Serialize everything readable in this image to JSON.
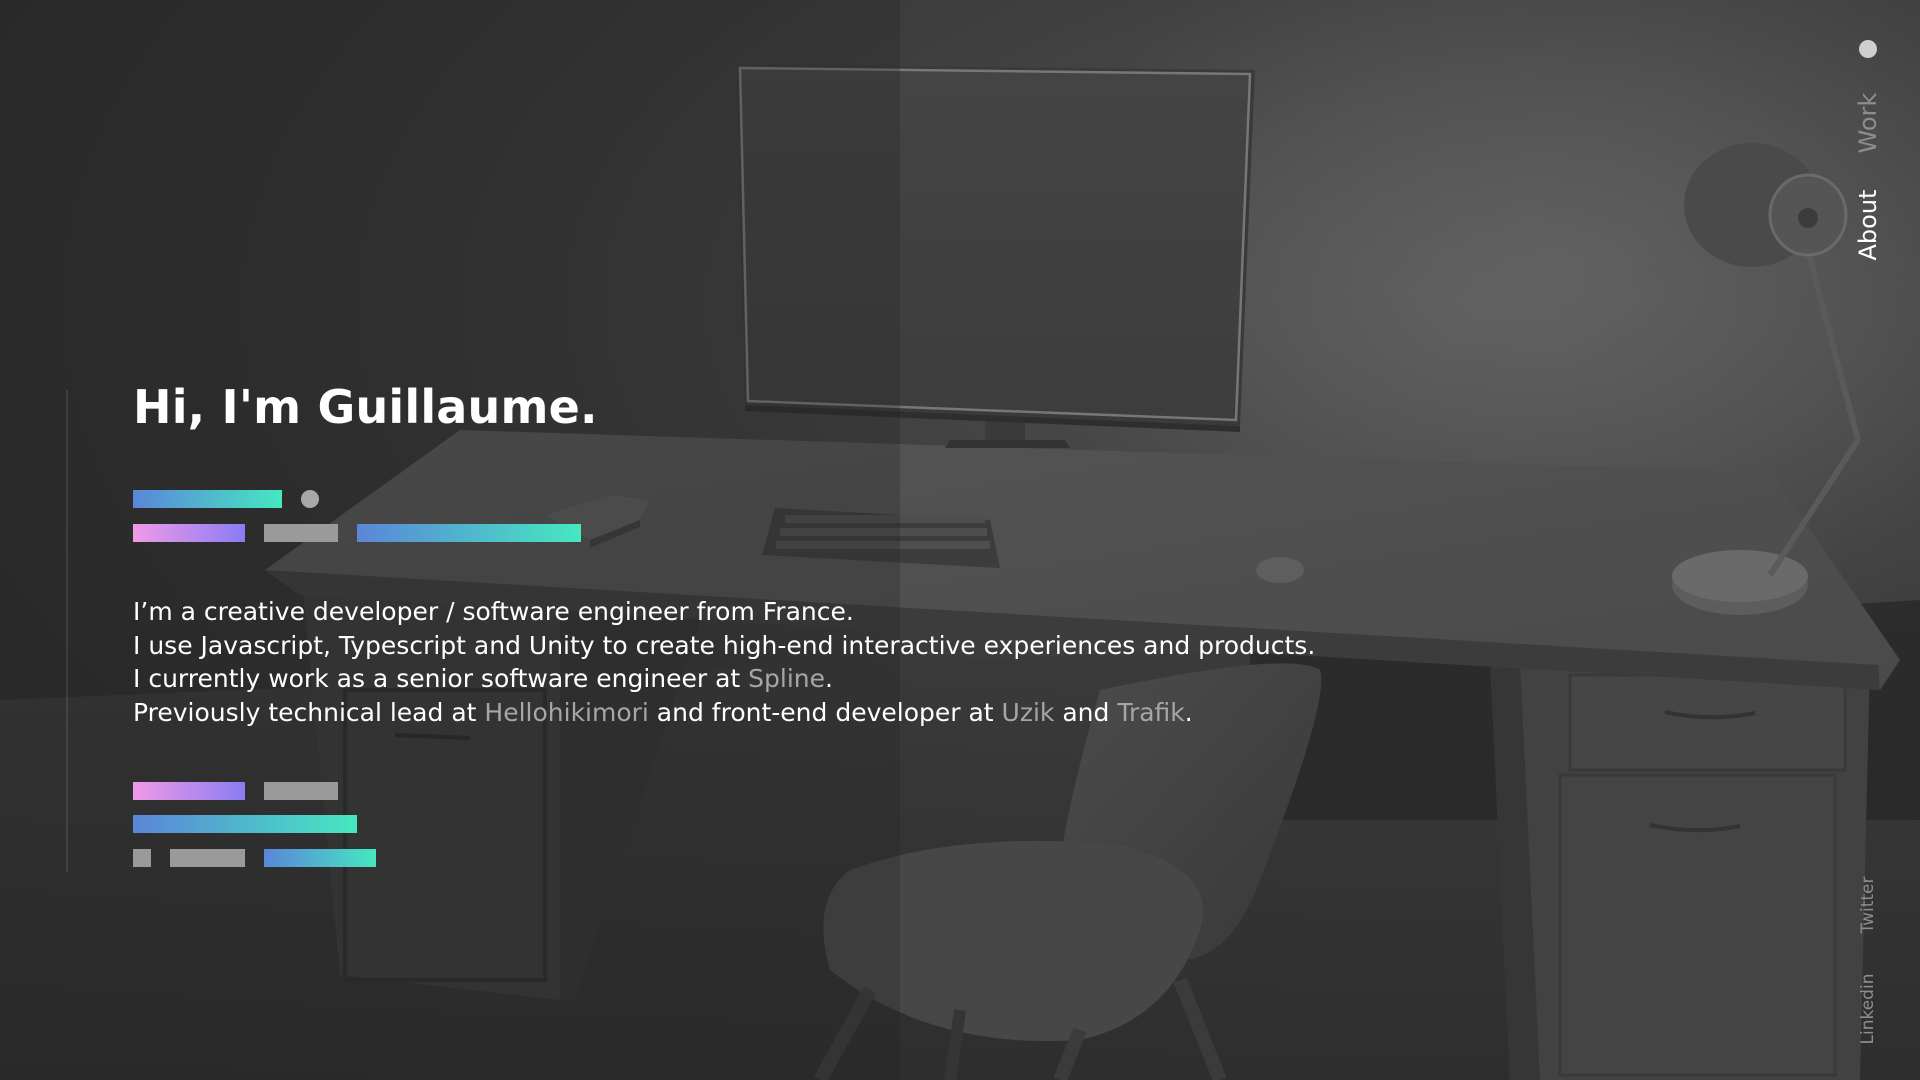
{
  "headline": "Hi, I'm Guillaume.",
  "bio": {
    "line1": "I’m a creative developer / software engineer from France.",
    "line2": "I use Javascript, Typescript and Unity to create high-end interactive experiences and products.",
    "line3_prefix": "I currently work as a senior software engineer at ",
    "line3_link": "Spline",
    "line3_suffix": ".",
    "line4_prefix": "Previously technical lead at ",
    "line4_link1": "Hellohikimori",
    "line4_mid1": " and front-end developer at ",
    "line4_link2": "Uzik",
    "line4_mid2": " and ",
    "line4_link3": "Trafik",
    "line4_suffix": "."
  },
  "nav": {
    "work_label": "Work",
    "about_label": "About",
    "twitter_label": "Twitter",
    "linkedin_label": "Linkedin"
  },
  "colors": {
    "accent_gradient_start": "#5b86d9",
    "accent_gradient_end": "#45e8c0",
    "pink_gradient_start": "#f09ae8",
    "pink_gradient_end": "#8a7cf2",
    "link_gray": "#a6a6a6"
  }
}
